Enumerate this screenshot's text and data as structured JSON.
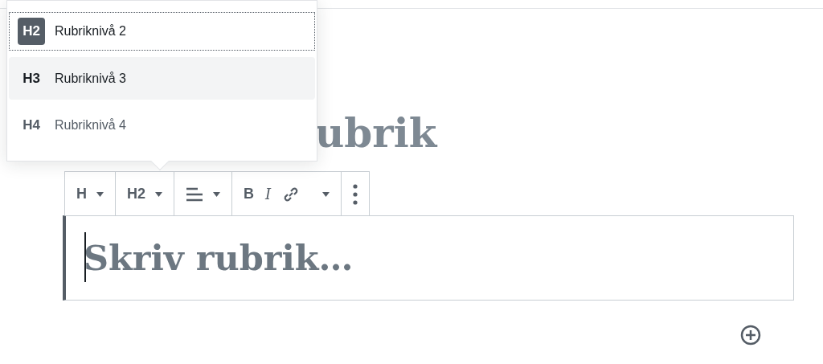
{
  "heading_menu": {
    "items": [
      {
        "badge": "H2",
        "label": "Rubriknivå 2",
        "selected": true,
        "hovered": false
      },
      {
        "badge": "H3",
        "label": "Rubriknivå 3",
        "selected": false,
        "hovered": true
      },
      {
        "badge": "H4",
        "label": "Rubriknivå 4",
        "selected": false,
        "hovered": false
      }
    ]
  },
  "title_fragment": "ubrik",
  "toolbar": {
    "groups": [
      [
        {
          "kind": "text",
          "text": "H",
          "caret": true
        }
      ],
      [
        {
          "kind": "text",
          "text": "H2",
          "caret": true
        }
      ],
      [
        {
          "kind": "align",
          "caret": true
        }
      ],
      [
        {
          "kind": "text",
          "text": "B",
          "caret": false
        },
        {
          "kind": "italic",
          "text": "I",
          "caret": false
        },
        {
          "kind": "link",
          "caret": false
        },
        {
          "kind": "menu",
          "caret": true
        }
      ],
      [
        {
          "kind": "more",
          "caret": false
        }
      ]
    ]
  },
  "heading_block": {
    "placeholder": "Skriv rubrik…"
  }
}
